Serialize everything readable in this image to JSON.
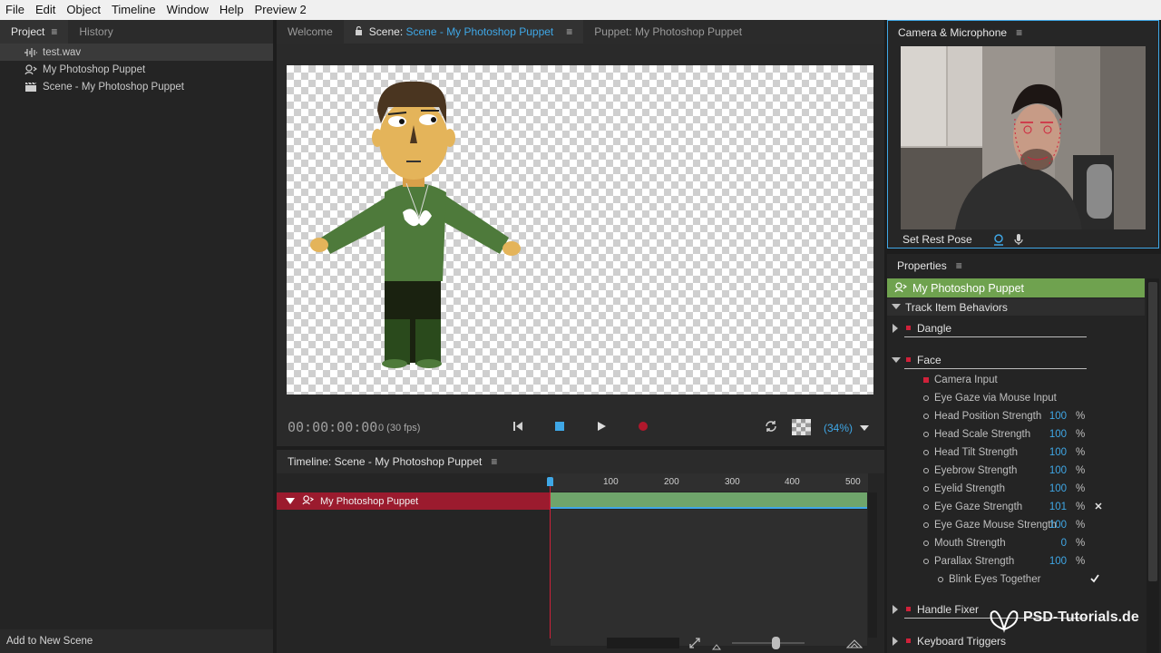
{
  "menu": [
    "File",
    "Edit",
    "Object",
    "Timeline",
    "Window",
    "Help",
    "Preview 2"
  ],
  "project": {
    "tabs": [
      "Project",
      "History"
    ],
    "items": [
      {
        "label": "test.wav",
        "icon": "audio-waveform-icon"
      },
      {
        "label": "My Photoshop Puppet",
        "icon": "puppet-icon"
      },
      {
        "label": "Scene - My Photoshop Puppet",
        "icon": "clapperboard-icon"
      }
    ],
    "footer": "Add to New Scene"
  },
  "scene": {
    "tabs": {
      "welcome": "Welcome",
      "scene_prefix": "Scene:",
      "scene_name": "Scene - My Photoshop Puppet",
      "puppet": "Puppet: My Photoshop Puppet"
    },
    "timecode": "00:00:00:00",
    "fps": "0 (30 fps)",
    "zoom": "(34%)"
  },
  "timeline": {
    "title": "Timeline: Scene - My Photoshop Puppet",
    "ticks": [
      "100",
      "200",
      "300",
      "400",
      "500"
    ],
    "track": "My Photoshop Puppet"
  },
  "camera": {
    "title": "Camera & Microphone",
    "rest_pose": "Set Rest Pose"
  },
  "properties": {
    "title": "Properties",
    "puppet": "My Photoshop Puppet",
    "section": "Track Item Behaviors",
    "behaviors": {
      "dangle": "Dangle",
      "face": "Face",
      "handle_fixer": "Handle Fixer",
      "keyboard_triggers": "Keyboard Triggers"
    },
    "face_params": [
      {
        "label": "Camera Input",
        "value": "",
        "unit": "",
        "marker": "square"
      },
      {
        "label": "Eye Gaze via Mouse Input",
        "value": "",
        "unit": "",
        "marker": "dot"
      },
      {
        "label": "Head Position Strength",
        "value": "100",
        "unit": "%",
        "marker": "dot"
      },
      {
        "label": "Head Scale Strength",
        "value": "100",
        "unit": "%",
        "marker": "dot"
      },
      {
        "label": "Head Tilt Strength",
        "value": "100",
        "unit": "%",
        "marker": "dot"
      },
      {
        "label": "Eyebrow Strength",
        "value": "100",
        "unit": "%",
        "marker": "dot"
      },
      {
        "label": "Eyelid Strength",
        "value": "100",
        "unit": "%",
        "marker": "dot"
      },
      {
        "label": "Eye Gaze Strength",
        "value": "101",
        "unit": "%",
        "marker": "dot"
      },
      {
        "label": "Eye Gaze Mouse Strength",
        "value": "100",
        "unit": "%",
        "marker": "dot"
      },
      {
        "label": "Mouth Strength",
        "value": "0",
        "unit": "%",
        "marker": "dot"
      },
      {
        "label": "Parallax Strength",
        "value": "100",
        "unit": "%",
        "marker": "dot"
      }
    ],
    "blink": "Blink Eyes Together"
  },
  "watermark": "PSD-Tutorials.de",
  "colors": {
    "accent": "#3fa7e6",
    "track_red": "#9b1b2e",
    "puppet_green": "#6fa24f"
  }
}
